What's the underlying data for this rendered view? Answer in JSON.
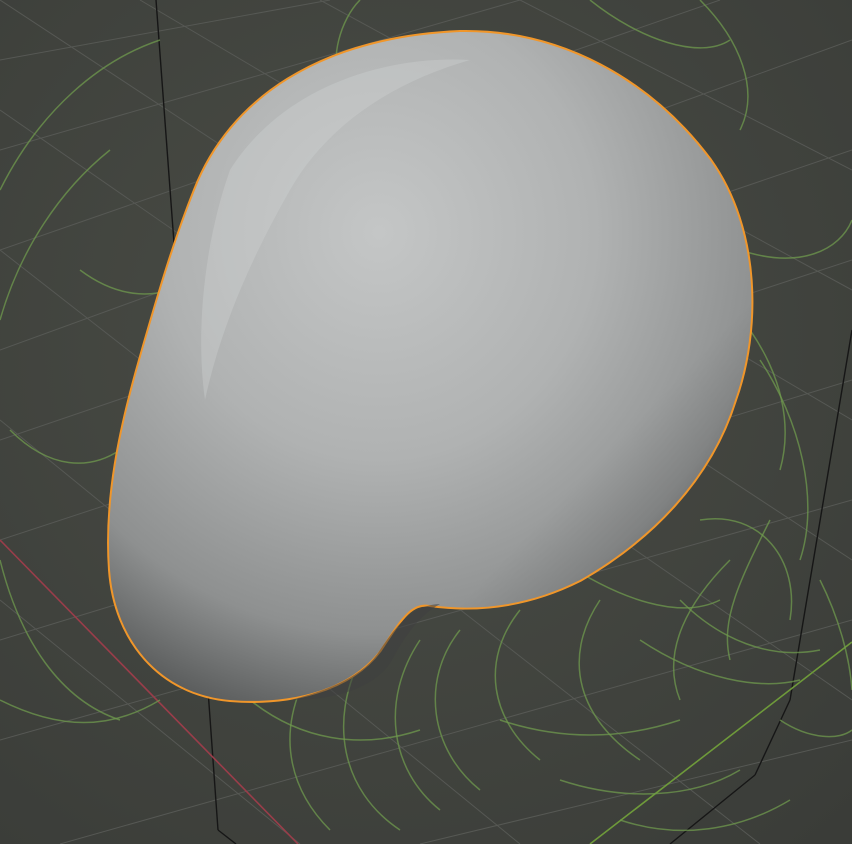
{
  "viewport": {
    "background_color": "#3d3d3d",
    "grid_color": "#505050",
    "x_axis_color": "#9a3d4a",
    "y_axis_color": "#6e9a3a",
    "gizmo_stroke_color": "#6f9a4e",
    "box_edge_color": "#161616"
  },
  "object": {
    "shape": "sculpted-blob",
    "selected": true,
    "selection_outline_color": "#f0962a",
    "surface_color": "#a6a8a8",
    "highlight_color": "#c4c6c6",
    "shadow_color": "#5a5c5c"
  }
}
